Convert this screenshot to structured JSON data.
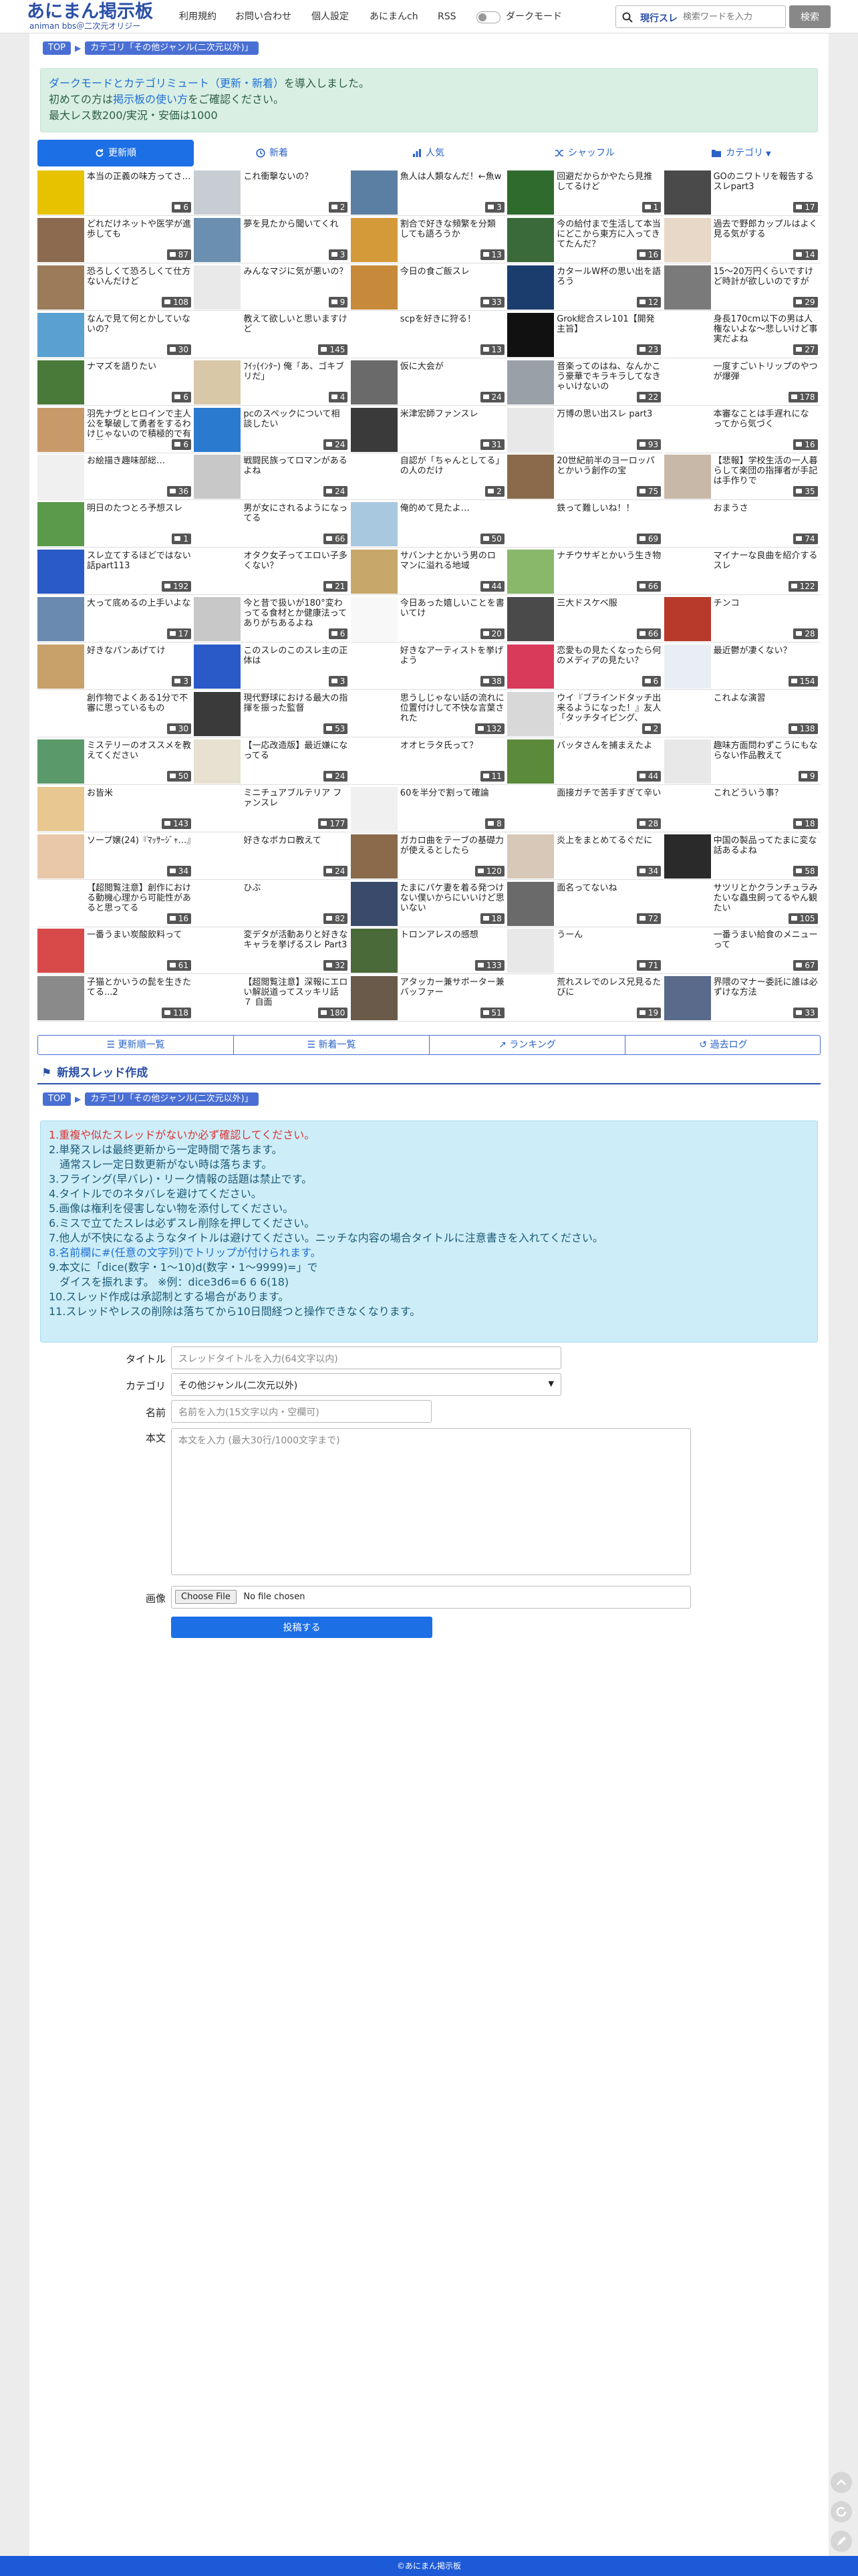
{
  "header": {
    "logo_title": "あにまん掲示板",
    "logo_sub": "animan bbs＠二次元オリジー",
    "nav": [
      "利用規約",
      "お問い合わせ",
      "個人設定",
      "あにまんch",
      "RSS"
    ],
    "dark_mode_label": "ダークモード",
    "search_label": "現行スレ",
    "search_placeholder": "検索ワードを入力",
    "search_button": "検索"
  },
  "breadcrumb": {
    "top": "TOP",
    "category": "カテゴリ「その他ジャンル(二次元以外)」"
  },
  "notice": {
    "line1_link": "ダークモードとカテゴリミュート（更新・新着）",
    "line1_rest": "を導入しました。",
    "line2_pre": "初めての方は",
    "line2_link": "掲示板の使い方",
    "line2_post": "をご確認ください。",
    "line3": "最大レス数200/実況・安価は1000"
  },
  "tabs": [
    "更新順",
    "新着",
    "人気",
    "シャッフル",
    "カテゴリ"
  ],
  "threads": [
    {
      "t": "本当の正義の味方ってさ…",
      "n": "6",
      "bg": "#e6c200"
    },
    {
      "t": "これ衝撃ないの？",
      "n": "2",
      "bg": "#c8cdd4"
    },
    {
      "t": "魚人は人類なんだ！←魚w",
      "n": "3",
      "bg": "#5b7fa3"
    },
    {
      "t": "回避だからかやたら見推してるけど",
      "n": "1",
      "bg": "#2f6b2d"
    },
    {
      "t": "GOのニワトリを報告するスレpart3",
      "n": "17",
      "bg": "#4a4a4a"
    },
    {
      "t": "どれだけネットや医学が進歩しても",
      "n": "87",
      "bg": "#8c6a4f"
    },
    {
      "t": "夢を見たから聞いてくれ",
      "n": "3",
      "bg": "#6a8fb0"
    },
    {
      "t": "割合で好きな頻繁を分類しても語ろうか",
      "n": "13",
      "bg": "#d49a3a"
    },
    {
      "t": "今の給付まで生活して本当にどこから東方に入ってきてたんだ？",
      "n": "16",
      "bg": "#3a6a3a"
    },
    {
      "t": "過去で野郎カップルはよく見る気がする",
      "n": "14",
      "bg": "#e8d8c8"
    },
    {
      "t": "恐ろしくて恐ろしくて仕方ないんだけど",
      "n": "108",
      "bg": "#9b7b5a"
    },
    {
      "t": "みんなマジに気が悪いの？",
      "n": "9",
      "bg": "#e9e9e9"
    },
    {
      "t": "今日の食ご飯スレ",
      "n": "33",
      "bg": "#c68a3a"
    },
    {
      "t": "カタールW杯の思い出を語ろう",
      "n": "12",
      "bg": "#1b3d6e"
    },
    {
      "t": "15〜20万円くらいですけど時計が欲しいのですが",
      "n": "29",
      "bg": "#7a7a7a"
    },
    {
      "t": "なんで見て何とかしていないの？",
      "n": "30",
      "bg": "#5aa0d0"
    },
    {
      "t": "教えて欲しいと思いますけど",
      "n": "145",
      "bg": "#ffffff"
    },
    {
      "t": "scpを好きに狩る！",
      "n": "13",
      "bg": "#ffffff"
    },
    {
      "t": "Grok総合スレ101【開発主旨】",
      "n": "23",
      "bg": "#111111"
    },
    {
      "t": "身長170cm以下の男は人権ないよな〜悲しいけど事実だよね",
      "n": "27",
      "bg": "#ffffff"
    },
    {
      "t": "ナマズを語りたい",
      "n": "6",
      "bg": "#4a7a3a"
    },
    {
      "t": "ﾌｲｯ(ｲﾝﾀｰ) 俺「あ、ゴキブリだ」",
      "n": "4",
      "bg": "#d8c8a8"
    },
    {
      "t": "仮に大会が",
      "n": "24",
      "bg": "#6a6a6a"
    },
    {
      "t": "音楽ってのはね、なんかこう豪華でキラキラしてなきゃいけないの",
      "n": "22",
      "bg": "#9aa0a8"
    },
    {
      "t": "一度すごいトリップのやつが爆弾",
      "n": "178",
      "bg": "#ffffff"
    },
    {
      "t": "羽先ナヴとヒロインで主人公を撃破して勇者をするわけじゃないので積極的で有り難く",
      "n": "6",
      "bg": "#c89a6a"
    },
    {
      "t": "pcのスペックについて相談したい",
      "n": "24",
      "bg": "#2a7ad0"
    },
    {
      "t": "米津宏師ファンスレ",
      "n": "31",
      "bg": "#3a3a3a"
    },
    {
      "t": "万博の思い出スレ part3",
      "n": "93",
      "bg": "#e8e8e8"
    },
    {
      "t": "本審なことは手遅れになってから気づく",
      "n": "16",
      "bg": "#ffffff"
    },
    {
      "t": "お絵描き趣味部総…",
      "n": "36",
      "bg": "#f0f0f0"
    },
    {
      "t": "戦闘民族ってロマンがあるよね",
      "n": "24",
      "bg": "#c8c8c8"
    },
    {
      "t": "自認が「ちゃんとしてる」の人のだけ",
      "n": "2",
      "bg": "#ffffff"
    },
    {
      "t": "20世紀前半のヨーロッパとかいう創作の宝",
      "n": "75",
      "bg": "#8a6a4a"
    },
    {
      "t": "【悲報】学校生活の一人暮らして楽団の指揮者が手記は手作りで",
      "n": "35",
      "bg": "#c8b8a8"
    },
    {
      "t": "明日のたつとろ予想スレ",
      "n": "1",
      "bg": "#5a9a4a"
    },
    {
      "t": "男が女にされるようになってる",
      "n": "66",
      "bg": "#ffffff"
    },
    {
      "t": "俺的めて見たよ…",
      "n": "50",
      "bg": "#a8c8e0"
    },
    {
      "t": "鉄って難しいね！！",
      "n": "69",
      "bg": "#ffffff"
    },
    {
      "t": "おまうさ",
      "n": "74",
      "bg": "#ffffff"
    },
    {
      "t": "スレ立てするほどではない話part113",
      "n": "192",
      "bg": "#2a5ac8"
    },
    {
      "t": "オタク女子ってエロい子多くない？",
      "n": "21",
      "bg": "#ffffff"
    },
    {
      "t": "サバンナとかいう男のロマンに溢れる地域",
      "n": "44",
      "bg": "#c8a86a"
    },
    {
      "t": "ナチウサギとかいう生き物",
      "n": "66",
      "bg": "#8ab86a"
    },
    {
      "t": "マイナーな良曲を紹介するスレ",
      "n": "122",
      "bg": "#ffffff"
    },
    {
      "t": "大って底めるの上手いよな",
      "n": "17",
      "bg": "#6a8ab0"
    },
    {
      "t": "今と昔で扱いが180°変わってる食材とか健康法ってありがちあるよね",
      "n": "6",
      "bg": "#c8c8c8"
    },
    {
      "t": "今日あった嬉しいことを書いてけ",
      "n": "20",
      "bg": "#f8f8f8"
    },
    {
      "t": "三大ドスケベ服",
      "n": "66",
      "bg": "#4a4a4a"
    },
    {
      "t": "チンコ",
      "n": "28",
      "bg": "#b83a2a"
    },
    {
      "t": "好きなパンあげてけ",
      "n": "3",
      "bg": "#c8a06a"
    },
    {
      "t": "このスレのこのスレ主の正体は",
      "n": "3",
      "bg": "#2a5ac8"
    },
    {
      "t": "好きなアーティストを挙げよう",
      "n": "38",
      "bg": "#ffffff"
    },
    {
      "t": "恋愛もの見たくなったら何のメディアの見たい？",
      "n": "6",
      "bg": "#d83a5a"
    },
    {
      "t": "最近鬱が凄くない？",
      "n": "154",
      "bg": "#e8eef4"
    },
    {
      "t": "創作物でよくある1分で不審に思っているもの",
      "n": "30",
      "bg": "#ffffff"
    },
    {
      "t": "現代野球における最大の指揮を振った監督",
      "n": "53",
      "bg": "#3a3a3a"
    },
    {
      "t": "思うしじゃない話の流れに位置付けして不快な言葉された",
      "n": "132",
      "bg": "#ffffff"
    },
    {
      "t": "ウイ『ブラインドタッチ出来るようになった！』友人「タッチタイピング、な？」",
      "n": "2",
      "bg": "#d8d8d8"
    },
    {
      "t": "これよな演習",
      "n": "138",
      "bg": "#ffffff"
    },
    {
      "t": "ミステリーのオススメを教えてください",
      "n": "50",
      "bg": "#5a9a6a"
    },
    {
      "t": "【一応改造版】最近嫌になってる",
      "n": "24",
      "bg": "#e8e0d0"
    },
    {
      "t": "オオヒラタ氏って？",
      "n": "11",
      "bg": "#ffffff"
    },
    {
      "t": "バッタさんを捕まえたよ",
      "n": "44",
      "bg": "#5a8a3a"
    },
    {
      "t": "趣味方面問わずこうにもならない作品教えて",
      "n": "9",
      "bg": "#e8e8e8"
    },
    {
      "t": "お皆米",
      "n": "143",
      "bg": "#e8c890"
    },
    {
      "t": "ミニチュアブルテリア ファンスレ",
      "n": "177",
      "bg": "#ffffff"
    },
    {
      "t": "60を半分で割って確論",
      "n": "8",
      "bg": "#f0f0f0"
    },
    {
      "t": "面接ガチで苦手すぎて辛い",
      "n": "28",
      "bg": "#ffffff"
    },
    {
      "t": "これどういう事？",
      "n": "18",
      "bg": "#ffffff"
    },
    {
      "t": "ソープ嬢(24)『ﾏｯｻｰｼﾞｬ…』",
      "n": "34",
      "bg": "#e8c8a8"
    },
    {
      "t": "好きなポカロ教えて",
      "n": "24",
      "bg": "#ffffff"
    },
    {
      "t": "ガカロ曲をテーブの基礎力が使えるとしたら",
      "n": "120",
      "bg": "#8a6a4a"
    },
    {
      "t": "炎上をまとめてるぐだに",
      "n": "34",
      "bg": "#d8c8b8"
    },
    {
      "t": "中国の製品ってたまに変な話あるよね",
      "n": "58",
      "bg": "#2a2a2a"
    },
    {
      "t": "【超閲覧注意】創作における動機心理から可能性があると思ってる",
      "n": "16",
      "bg": "#ffffff"
    },
    {
      "t": "ひぶ",
      "n": "82",
      "bg": "#ffffff"
    },
    {
      "t": "たまにパケ妻を着る発つけない僕いからにいいけど思いない",
      "n": "18",
      "bg": "#3a4a6a"
    },
    {
      "t": "面名ってないね",
      "n": "72",
      "bg": "#6a6a6a"
    },
    {
      "t": "サツリとかクランチュラみたいな蟲虫飼ってるやん観たい",
      "n": "105",
      "bg": "#ffffff"
    },
    {
      "t": "一番うまい炭酸飲料って",
      "n": "61",
      "bg": "#d84a4a"
    },
    {
      "t": "変デタが活動ありと好きなキャラを挙げるスレ Part3",
      "n": "32",
      "bg": "#ffffff"
    },
    {
      "t": "トロンアレスの感想",
      "n": "133",
      "bg": "#4a6a3a"
    },
    {
      "t": "うーん",
      "n": "71",
      "bg": "#e8e8e8"
    },
    {
      "t": "一番うまい給食のメニューって",
      "n": "67",
      "bg": "#ffffff"
    },
    {
      "t": "子猫とかいうの髭を生きたてる...2",
      "n": "118",
      "bg": "#8a8a8a"
    },
    {
      "t": "【超閲覧注意】深報にエロい解説道ってスッキリ話 ７ 自面",
      "n": "180",
      "bg": "#ffffff"
    },
    {
      "t": "アタッカー兼サポーター兼バッファー",
      "n": "51",
      "bg": "#6a5a4a"
    },
    {
      "t": "荒れスレでのレス兄見るたびに",
      "n": "19",
      "bg": "#ffffff"
    },
    {
      "t": "界隈のマナー委託に誰は必ずけな方法",
      "n": "33",
      "bg": "#5a6a8a"
    }
  ],
  "bottom_links": [
    "更新順一覧",
    "新着一覧",
    "ランキング",
    "過去ログ"
  ],
  "new_thread": {
    "heading": "新規スレッド作成",
    "rules": [
      "1.重複や似たスレッドがないか必ず確認してください。",
      "2.単発スレは最終更新から一定時間で落ちます。",
      "　通常スレ一定日数更新がない時は落ちます。",
      "3.フライング(早バレ)・リーク情報の話題は禁止です。",
      "4.タイトルでのネタバレを避けてください。",
      "5.画像は権利を侵害しない物を添付してください。",
      "6.ミスで立てたスレは必ずスレ削除を押してください。",
      "7.他人が不快になるようなタイトルは避けてください。ニッチな内容の場合タイトルに注意書きを入れてください。",
      "8.名前欄に#(任意の文字列)でトリップが付けられます。",
      "9.本文に「dice(数字・1〜10)d(数字・1〜9999)=」で",
      "　ダイスを振れます。 ※例：dice3d6=6 6 6(18)",
      "10.スレッド作成は承認制とする場合があります。",
      "11.スレッドやレスの削除は落ちてから10日間経つと操作できなくなります。"
    ],
    "label_title": "タイトル",
    "placeholder_title": "スレッドタイトルを入力(64文字以内)",
    "label_category": "カテゴリ",
    "category_value": "その他ジャンル(二次元以外)",
    "label_name": "名前",
    "placeholder_name": "名前を入力(15文字以内・空欄可)",
    "label_body": "本文",
    "placeholder_body": "本文を入力 (最大30行/1000文字まで)",
    "label_image": "画像",
    "file_button": "Choose File",
    "file_status": "No file chosen",
    "submit": "投稿する"
  },
  "footer": "©あにまん掲示板"
}
